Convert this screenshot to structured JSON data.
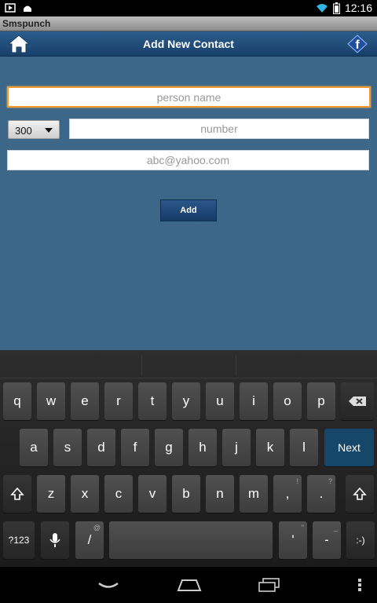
{
  "status_bar": {
    "time": "12:16",
    "left_icons": [
      "media-play-icon",
      "android-icon"
    ],
    "right_icons": [
      "wifi-icon",
      "battery-icon"
    ]
  },
  "app": {
    "title": "Smspunch"
  },
  "header": {
    "title": "Add New Contact",
    "home_icon": "home-icon",
    "facebook_icon": "facebook-icon"
  },
  "form": {
    "name_placeholder": "person name",
    "country_code": "300",
    "number_placeholder": "number",
    "email_placeholder": "abc@yahoo.com",
    "add_label": "Add"
  },
  "keyboard": {
    "row1": [
      "q",
      "w",
      "e",
      "r",
      "t",
      "y",
      "u",
      "i",
      "o",
      "p"
    ],
    "row2": [
      "a",
      "s",
      "d",
      "f",
      "g",
      "h",
      "j",
      "k",
      "l"
    ],
    "row3": [
      "z",
      "x",
      "c",
      "v",
      "b",
      "n",
      "m",
      ",",
      "."
    ],
    "row3_hints": [
      "",
      "",
      "",
      "",
      "",
      "",
      "",
      "!",
      "?"
    ],
    "next_label": "Next",
    "symbols_label": "?123",
    "slash": "/",
    "slash_hint": "@",
    "apostrophe": "'",
    "apostrophe_hint": "\"",
    "dash": "-",
    "dash_hint": "_",
    "smiley": ":-)",
    "accent": "#16476a"
  },
  "nav": {
    "icons": [
      "back-icon",
      "home-icon",
      "recents-icon",
      "menu-icon"
    ]
  }
}
